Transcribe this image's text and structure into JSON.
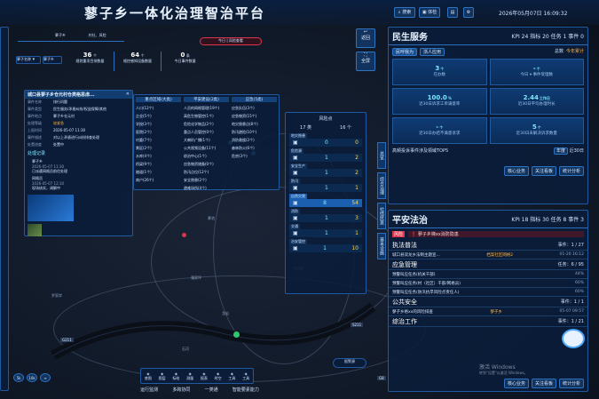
{
  "header": {
    "title": "蓼子乡一体化治理智治平台",
    "search": "搜索",
    "system": "体检",
    "datetime": "2026年05月07日 16:09:32"
  },
  "map": {
    "location": "蓼子乡",
    "filter_label": "村社、风险",
    "stats": [
      {
        "value": "36",
        "unit": "个",
        "label": "规划重项目排数量"
      },
      {
        "value": "64",
        "unit": "个",
        "label": "格控感知设备数量"
      },
      {
        "value": "0",
        "unit": "条",
        "label": "今日事件数量"
      }
    ],
    "route_chip": "今日 | 风险查看",
    "place_labels": [
      "蓼池",
      "罗家岸",
      "石河",
      "平凉坝",
      "龙岩",
      "蒲家坪"
    ],
    "roads": [
      "G211",
      "G211",
      "S211",
      "G8"
    ],
    "hover_label": "报警源",
    "bottom_nav": [
      "运行监测",
      "多跨协同",
      "一类通",
      "智能要素能力"
    ],
    "bottom_tools": [
      "底图",
      "图层",
      "标绘",
      "测量",
      "报表",
      "时空",
      "工具",
      "工具"
    ],
    "zoom_buttons": [
      "5k",
      "10k",
      "∞"
    ],
    "back_label": "返回",
    "full_label": "全屏"
  },
  "left_toolbar": {
    "select": "蓼子名称",
    "options": [
      "蓼子乡"
    ]
  },
  "event_popup": {
    "title": "城口县蓼子乡仓元村仓类格思虑...",
    "fields": [
      {
        "label": "事件名称",
        "value": "排行问题"
      },
      {
        "label": "事件类型",
        "value": "民生服务/矛盾纠纷/权益保障/其他"
      },
      {
        "label": "事件地点",
        "value": "蓼子乡仓元村"
      },
      {
        "label": "处理等级",
        "value": "较紧急"
      },
      {
        "label": "上报时间",
        "value": "2026-05-07 11:30"
      },
      {
        "label": "事件描述",
        "value": "对以上矛盾进行纠纷排查处理"
      },
      {
        "label": "处置进度",
        "value": "处置中"
      }
    ],
    "section": "处理记录",
    "log": [
      {
        "name": "蓼子乡",
        "time": "2026-05-07 11:30",
        "text": "已派遣网格员前往处理"
      },
      {
        "name": "网格员",
        "time": "2026-05-07 12:10",
        "text": "现场核实，调解中"
      }
    ]
  },
  "layer_menu": {
    "cols": [
      {
        "title": "重点区域(大类)",
        "items": [
          "人口(12个)",
          "企业(5个)",
          "学校(3个)",
          "医院(2个)",
          "村委(7个)",
          "景区(2个)",
          "水库(4个)",
          "桥梁(9个)",
          "隧道(1个)",
          "商户(26个)"
        ]
      },
      {
        "title": "平安建设(2类)",
        "items": [
          "人员的网格管理(19个)",
          "高危生物管控(1个)",
          "危险化学物品(2个)",
          "重点人员管控(0个)",
          "大喇叭广播(1个)",
          "公共视频设备(11个)",
          "综治中心(1个)",
          "应急物资储备(0个)",
          "防汛点位(12个)",
          "安全隐患(2个)",
          "避难场所(4个)"
        ]
      },
      {
        "title": "应急(5类)",
        "items": [
          "应急队伍(3个)",
          "应急物资(15个)",
          "地灾隐患点(8个)",
          "防汛避险(10个)",
          "消防救援(2个)",
          "森林防火(6个)",
          "危房(3个)"
        ]
      }
    ]
  },
  "risk_panel": {
    "title": "风险点",
    "cols": [
      "17 类",
      "16 个"
    ],
    "rows": [
      {
        "name": "地灾隐患",
        "a": "0",
        "b": "0"
      },
      {
        "name": "危险源",
        "a": "1",
        "b": "2"
      },
      {
        "name": "安全生产",
        "a": "1",
        "b": "2"
      },
      {
        "name": "防汛",
        "a": "1",
        "b": "1"
      },
      {
        "name": "自然灾害",
        "a": "8",
        "b": "54"
      },
      {
        "name": "消防",
        "a": "1",
        "b": "3"
      },
      {
        "name": "交通",
        "a": "1",
        "b": "1"
      },
      {
        "name": "治安管控",
        "a": "1",
        "b": "10"
      }
    ]
  },
  "side_tabs": [
    "总览",
    "综合治理",
    "社情民意",
    "基本设施"
  ],
  "livelihood": {
    "title": "民生服务",
    "kpi": "KPI 24 指标 20 任务 1 事件 0",
    "tabs": [
      "民呼我为",
      "浙人应用",
      "总数",
      "今年累计"
    ],
    "tiles": [
      {
        "value": "3",
        "unit": "个",
        "label": "在办数"
      },
      {
        "value": "-",
        "unit": "个",
        "label": "今日 ▾ 事件受理数"
      },
      {
        "value": "100.0",
        "unit": "%",
        "label": "近30日诉求工单满意率"
      },
      {
        "value": "2.44",
        "unit": "工作日",
        "label": "近30日平均办理时长"
      },
      {
        "value": "-",
        "unit": "个",
        "label": "近30日办结不满意诉求"
      },
      {
        "value": "5",
        "unit": "个",
        "label": "近30日未解决诉求数量"
      }
    ],
    "top5": "高频投诉事件涉及领域TOP5",
    "top5_tabs": [
      "年度",
      "近30日"
    ],
    "buttons": [
      "核心业务",
      "关注看板",
      "统计分析"
    ]
  },
  "safety": {
    "title": "平安法治",
    "kpi": "KPI 18 指标 30 任务 8 事件 3",
    "risk_tag": "风险",
    "risk_text": "蓼子乡梯xx消防隐患",
    "sections": [
      {
        "name": "执法普法",
        "task": "事件：1 / 27",
        "items": [
          {
            "text": "城口县双龙乡法制主题宣...",
            "tag": "档案社区网格2",
            "time": "01-20 16:12"
          }
        ]
      },
      {
        "name": "应急管理",
        "task": "任务：6 / 95",
        "items": [
          {
            "text": "预警叫应任务(机关干部)",
            "tag": "",
            "time": "44%"
          },
          {
            "text": "预警叫应任务(村（社区）干部/网格员)",
            "tag": "",
            "time": "60%"
          },
          {
            "text": "预警叫应任务(防汛抗旱风险点责任人)",
            "tag": "",
            "time": "60%"
          }
        ]
      },
      {
        "name": "公共安全",
        "task": "事件：1 / 1",
        "items": [
          {
            "text": "蓼子乡格xx的风险排查",
            "tag": "蓼子乡",
            "time": "05-07 09:57"
          }
        ]
      },
      {
        "name": "综治工作",
        "task": "事件：1 / 21",
        "items": []
      }
    ],
    "tag_label": "风险",
    "buttons": [
      "核心业务",
      "关注看板",
      "统计分析"
    ]
  },
  "watermark": {
    "line1": "激活 Windows",
    "line2": "转到\"设置\"以激活 Windows。"
  },
  "colors": {
    "accent": "#2d74c4",
    "cyan": "#7fe6ff",
    "danger": "#e0344a",
    "orange": "#ffb340"
  }
}
